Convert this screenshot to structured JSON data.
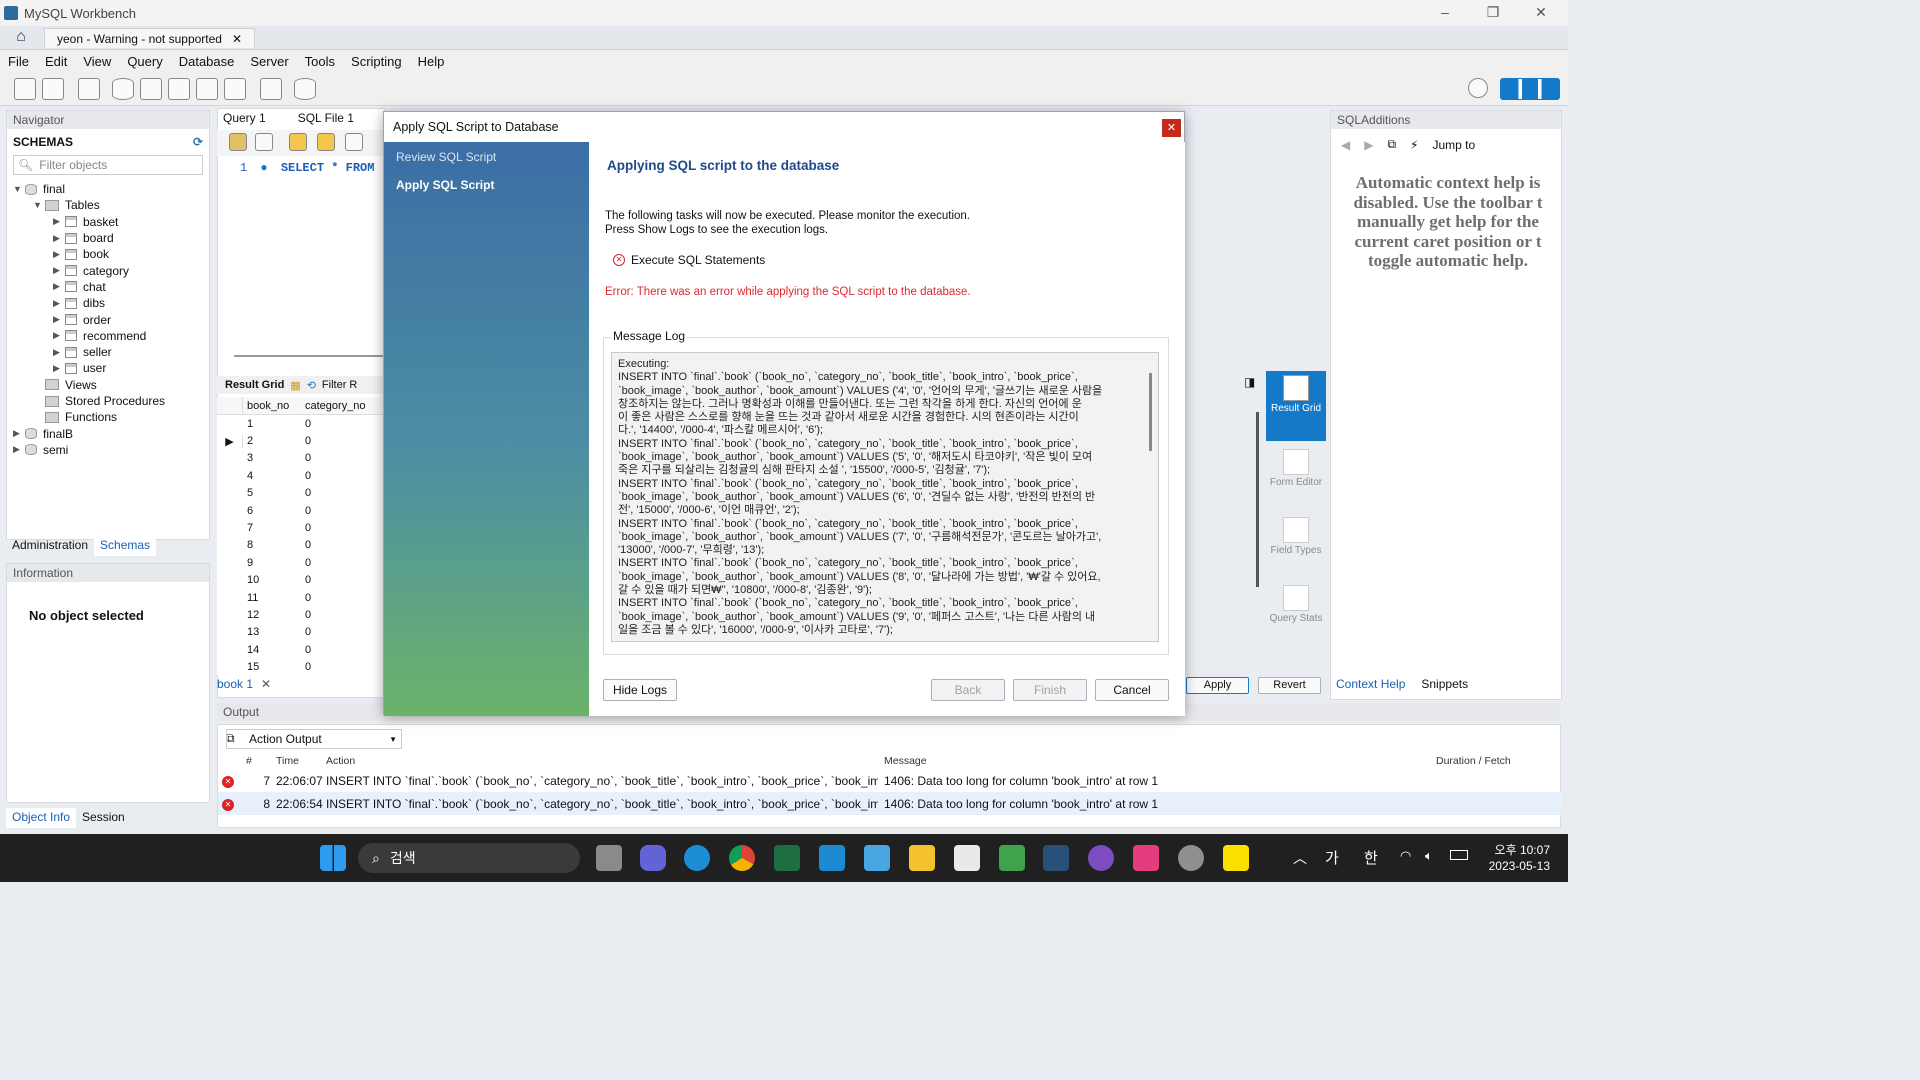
{
  "window": {
    "title": "MySQL Workbench",
    "connection_tab": "yeon - Warning - not supported"
  },
  "menu": [
    "File",
    "Edit",
    "View",
    "Query",
    "Database",
    "Server",
    "Tools",
    "Scripting",
    "Help"
  ],
  "navigator": {
    "header": "Navigator",
    "schemas_title": "SCHEMAS",
    "filter_placeholder": "Filter objects",
    "db_final": "final",
    "tables_label": "Tables",
    "tables": [
      "basket",
      "board",
      "book",
      "category",
      "chat",
      "dibs",
      "order",
      "recommend",
      "seller",
      "user"
    ],
    "views": "Views",
    "procs": "Stored Procedures",
    "funcs": "Functions",
    "db2": "finalB",
    "db3": "semi",
    "tabs": [
      "Administration",
      "Schemas"
    ],
    "info_header": "Information",
    "no_object": "No object selected",
    "bottom_tabs": [
      "Object Info",
      "Session"
    ]
  },
  "editor": {
    "tabs": [
      "Query 1",
      "SQL File 1"
    ],
    "line_no": "1",
    "sql": "SELECT * FROM",
    "result_grid": "Result Grid",
    "filter": "Filter R",
    "grid_cols": [
      "book_no",
      "category_no"
    ],
    "grid_rows": [
      [
        "1",
        "0"
      ],
      [
        "2",
        "0"
      ],
      [
        "3",
        "0"
      ],
      [
        "4",
        "0"
      ],
      [
        "5",
        "0"
      ],
      [
        "6",
        "0"
      ],
      [
        "7",
        "0"
      ],
      [
        "8",
        "0"
      ],
      [
        "9",
        "0"
      ],
      [
        "10",
        "0"
      ],
      [
        "11",
        "0"
      ],
      [
        "12",
        "0"
      ],
      [
        "13",
        "0"
      ],
      [
        "14",
        "0"
      ],
      [
        "15",
        "0"
      ]
    ],
    "book_tab": "book 1"
  },
  "dialog": {
    "title": "Apply SQL Script to Database",
    "steps": [
      "Review SQL Script",
      "Apply SQL Script"
    ],
    "heading": "Applying SQL script to the database",
    "desc1": "The following tasks will now be executed. Please monitor the execution.",
    "desc2": "Press Show Logs to see the execution logs.",
    "task": "Execute SQL Statements",
    "error": "Error: There was an error while applying the SQL script to the database.",
    "log_label": "Message Log",
    "log_lines": [
      "Executing:",
      "INSERT INTO `final`.`book` (`book_no`, `category_no`, `book_title`, `book_intro`, `book_price`,",
      "`book_image`, `book_author`, `book_amount`) VALUES ('4', '0', '언어의 무게', '글쓰기는 새로운 사람을",
      "창조하지는 않는다. 그러나 명확성과 이해를 만들어낸다. 또는 그런 착각을 하게 한다. 자신의 언어에 운",
      "이 좋은 사람은 스스로를 향해 눈을 뜨는 것과 같아서 새로운 시간을 경험한다. 시의 현존이라는 시간이",
      "다.', '14400', '/000-4', '파스칼 메르시어', '6');",
      "INSERT INTO `final`.`book` (`book_no`, `category_no`, `book_title`, `book_intro`, `book_price`,",
      "`book_image`, `book_author`, `book_amount`) VALUES ('5', '0', '해저도시 타코야키', '작은 빛이 모여",
      "죽은 지구를 되살리는 김청귤의 심해 판타지 소설 ', '15500', '/000-5', '김청귤', '7');",
      "INSERT INTO `final`.`book` (`book_no`, `category_no`, `book_title`, `book_intro`, `book_price`,",
      "`book_image`, `book_author`, `book_amount`) VALUES ('6', '0', '견딜수 없는 사랑', '반전의 반전의 반",
      "전', '15000', '/000-6', '이언 매큐언', '2');",
      "INSERT INTO `final`.`book` (`book_no`, `category_no`, `book_title`, `book_intro`, `book_price`,",
      "`book_image`, `book_author`, `book_amount`) VALUES ('7', '0', '구름해석전문가', '콘도르는 날아가고',",
      "'13000', '/000-7', '무희령', '13');",
      "INSERT INTO `final`.`book` (`book_no`, `category_no`, `book_title`, `book_intro`, `book_price`,",
      "`book_image`, `book_author`, `book_amount`) VALUES ('8', '0', '달나라에 가는 방법', '₩'갈 수 있어요,",
      "갈 수 있을 때가 되면₩'', '10800', '/000-8', '김종완', '9');",
      "INSERT INTO `final`.`book` (`book_no`, `category_no`, `book_title`, `book_intro`, `book_price`,",
      "`book_image`, `book_author`, `book_amount`) VALUES ('9', '0', '페퍼스 고스트', '나는 다른 사람의 내",
      "일을 조금 볼 수 있다', '16000', '/000-9', '이사카 고타로', '7');"
    ],
    "buttons": {
      "hide_logs": "Hide Logs",
      "back": "Back",
      "finish": "Finish",
      "cancel": "Cancel"
    }
  },
  "right": {
    "header": "SQLAdditions",
    "jump_to": "Jump to",
    "help": "Automatic context help is disabled. Use the toolbar t manually get help for the current caret position or t toggle automatic help.",
    "tabs": [
      "Context Help",
      "Snippets"
    ],
    "tools": [
      "Result Grid",
      "Form Editor",
      "Field Types",
      "Query Stats"
    ],
    "apply": "Apply",
    "revert": "Revert"
  },
  "output": {
    "header": "Output",
    "selector": "Action Output",
    "cols": [
      "#",
      "Time",
      "Action",
      "Message",
      "Duration / Fetch"
    ],
    "rows": [
      {
        "n": "7",
        "time": "22:06:07",
        "action": "INSERT INTO `final`.`book` (`book_no`, `category_no`, `book_title`, `book_intro`, `book_price`, `book_image`, `...",
        "msg": "1406: Data too long for column 'book_intro' at row 1"
      },
      {
        "n": "8",
        "time": "22:06:54",
        "action": "INSERT INTO `final`.`book` (`book_no`, `category_no`, `book_title`, `book_intro`, `book_price`, `book_image`, `...",
        "msg": "1406: Data too long for column 'book_intro' at row 1"
      }
    ]
  },
  "taskbar": {
    "search": "검색",
    "ime1": "가",
    "ime2": "한",
    "time": "오후 10:07",
    "date": "2023-05-13"
  }
}
